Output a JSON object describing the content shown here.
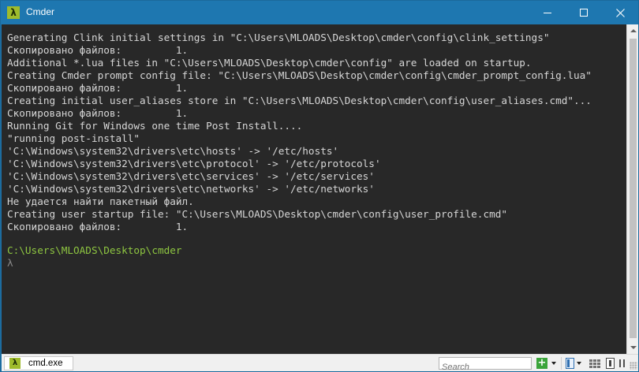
{
  "window": {
    "title": "Cmder",
    "app_icon_glyph": "λ",
    "controls": [
      "minimize-icon",
      "maximize-icon",
      "close-icon"
    ]
  },
  "terminal": {
    "lines": [
      "Generating Clink initial settings in \"C:\\Users\\MLOADS\\Desktop\\cmder\\config\\clink_settings\"",
      "Скопировано файлов:         1.",
      "Additional *.lua files in \"C:\\Users\\MLOADS\\Desktop\\cmder\\config\" are loaded on startup.",
      "Creating Cmder prompt config file: \"C:\\Users\\MLOADS\\Desktop\\cmder\\config\\cmder_prompt_config.lua\"",
      "Скопировано файлов:         1.",
      "Creating initial user_aliases store in \"C:\\Users\\MLOADS\\Desktop\\cmder\\config\\user_aliases.cmd\"...",
      "Скопировано файлов:         1.",
      "Running Git for Windows one time Post Install....",
      "\"running post-install\"",
      "'C:\\Windows\\system32\\drivers\\etc\\hosts' -> '/etc/hosts'",
      "'C:\\Windows\\system32\\drivers\\etc\\protocol' -> '/etc/protocols'",
      "'C:\\Windows\\system32\\drivers\\etc\\services' -> '/etc/services'",
      "'C:\\Windows\\system32\\drivers\\etc\\networks' -> '/etc/networks'",
      "Не удается найти пакетный файл.",
      "Creating user startup file: \"C:\\Users\\MLOADS\\Desktop\\cmder\\config\\user_profile.cmd\"",
      "Скопировано файлов:         1."
    ],
    "cwd": "C:\\Users\\MLOADS\\Desktop\\cmder",
    "prompt": "λ",
    "colors": {
      "background": "#282828",
      "text": "#d6d6d6",
      "cwd": "#8ec641",
      "prompt": "#8a8a8a"
    }
  },
  "statusbar": {
    "tab_icon_glyph": "λ",
    "tab_label": "cmd.exe",
    "search_placeholder": "Search",
    "new_console_glyph": "+"
  },
  "theme": {
    "titlebar": "#1e77b0",
    "app_icon": "#9ebb2c"
  }
}
